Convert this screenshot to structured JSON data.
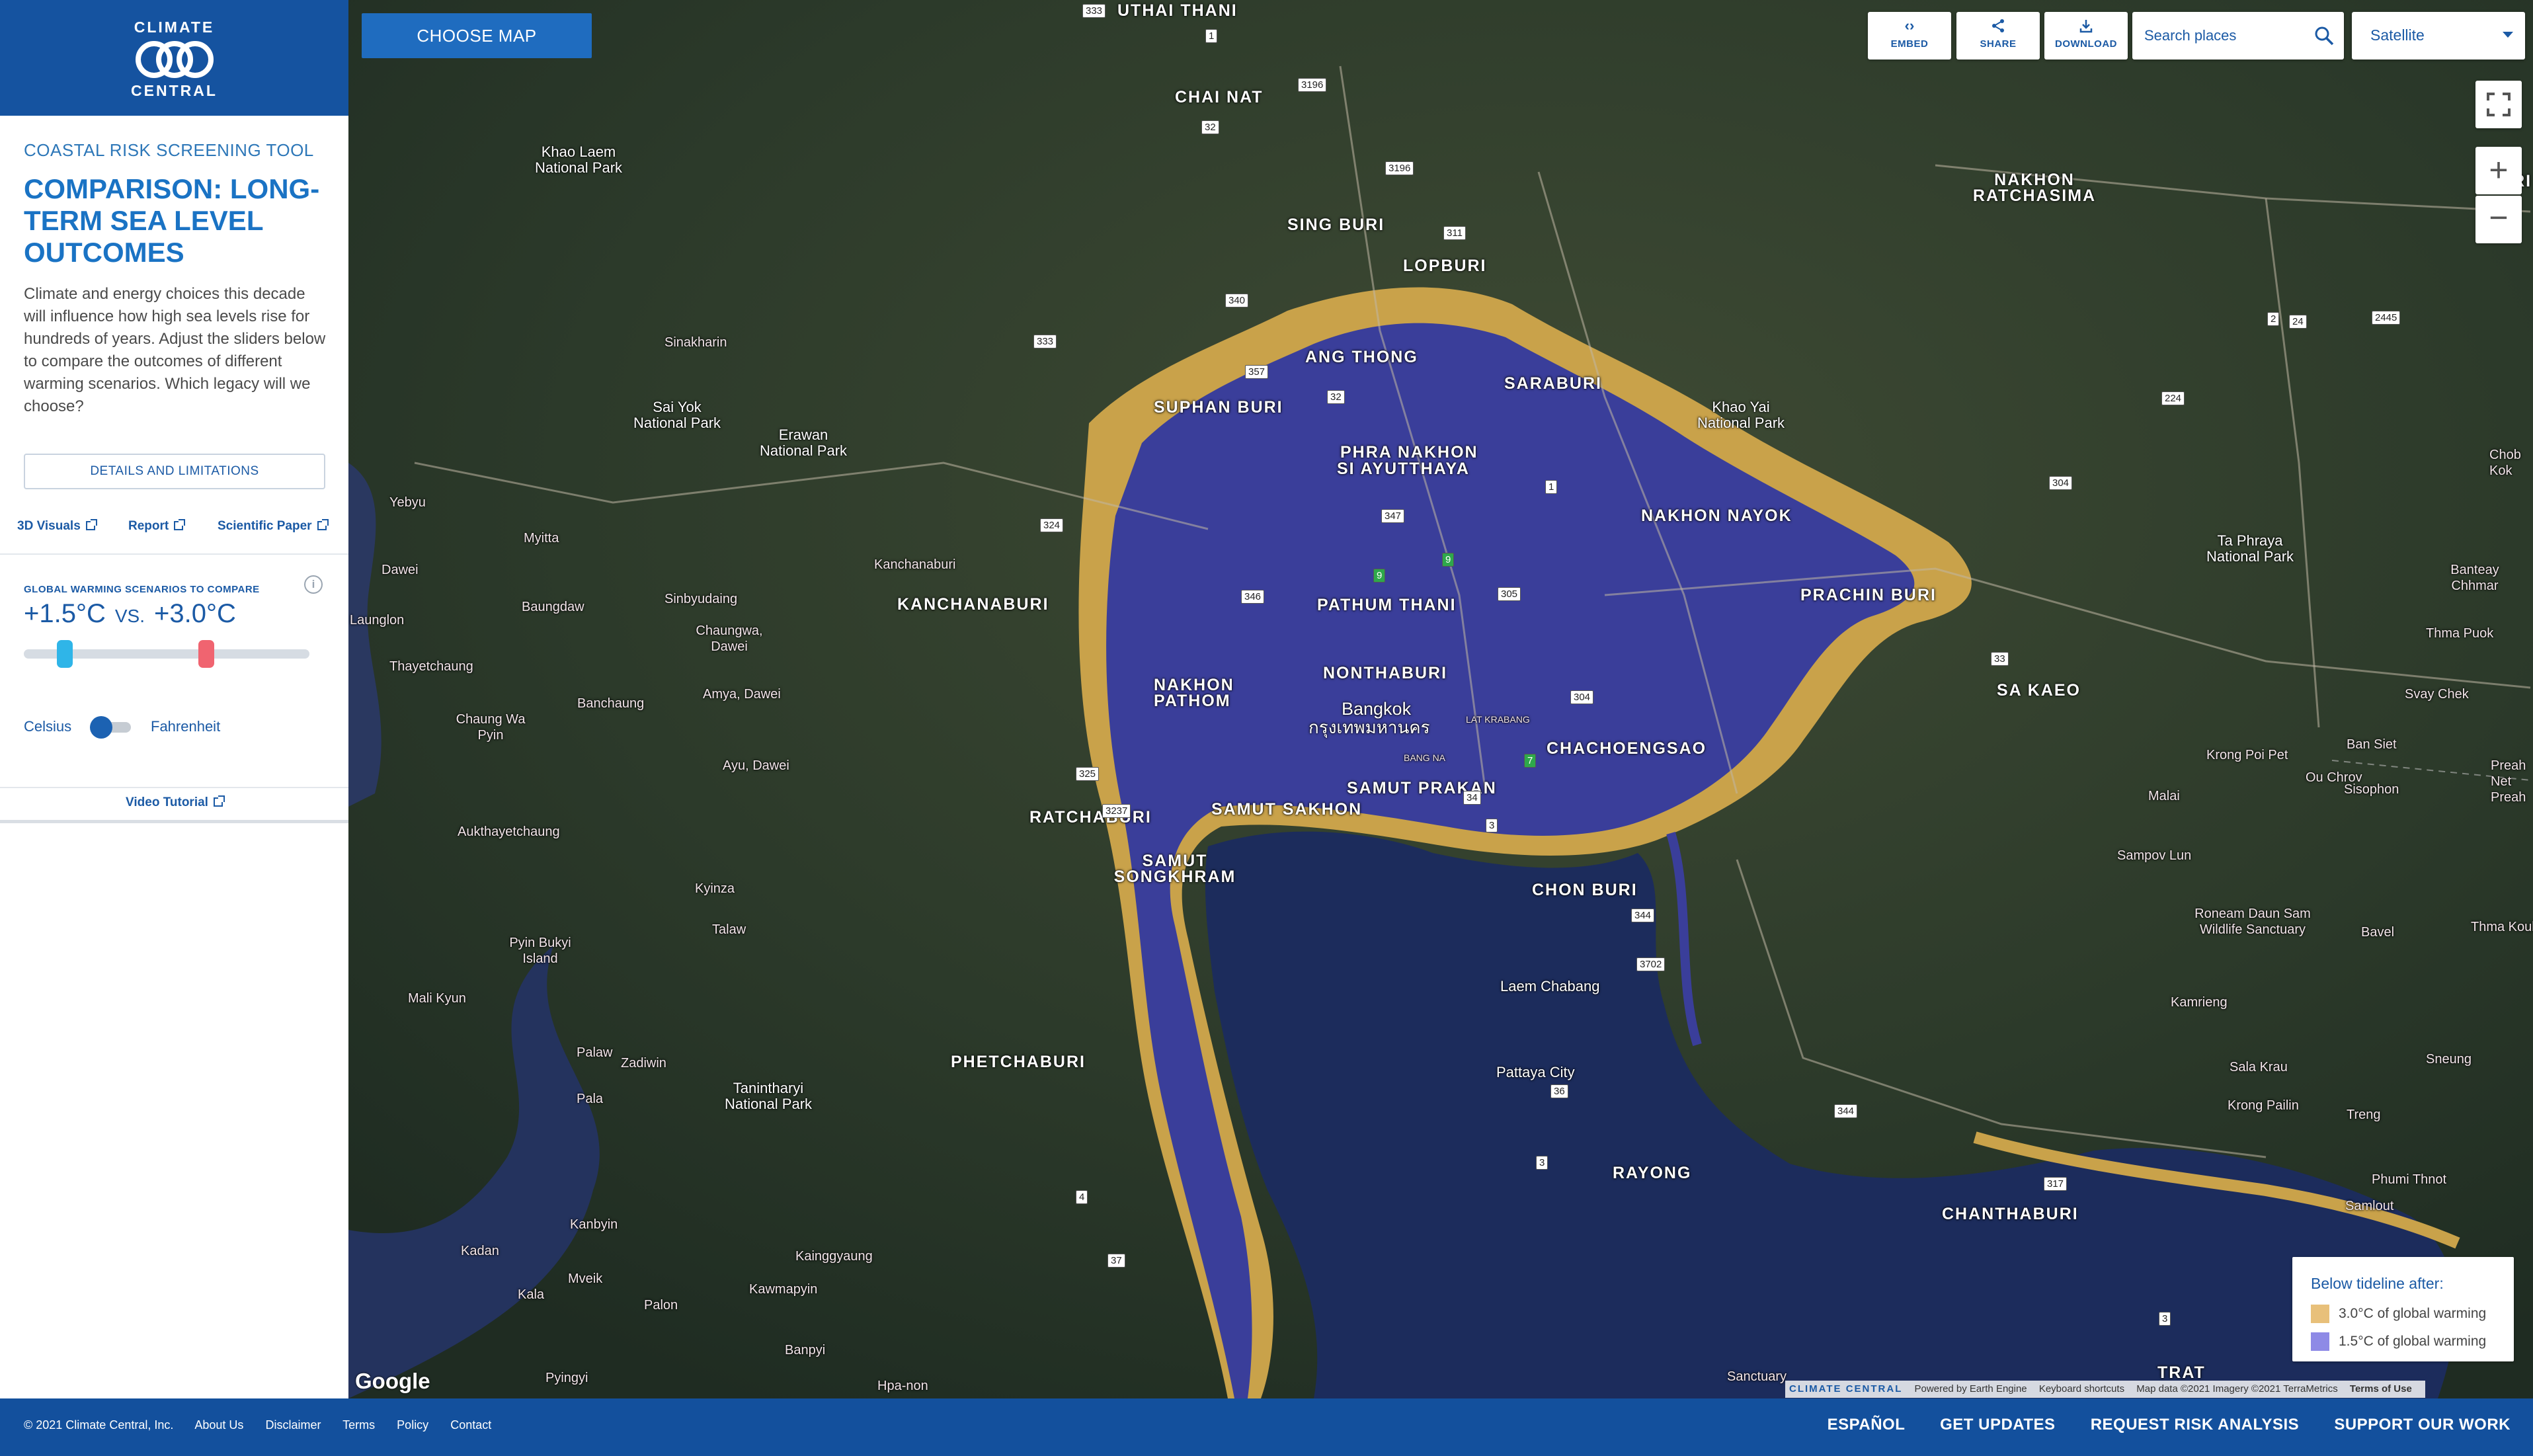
{
  "logo": {
    "line1": "CLIMATE",
    "line2": "CENTRAL"
  },
  "sidebar": {
    "tool_label": "COASTAL RISK SCREENING TOOL",
    "headline": "COMPARISON: LONG-TERM SEA LEVEL OUTCOMES",
    "intro": "Climate and energy choices this decade will influence how high sea levels rise for hundreds of years. Adjust the sliders below to compare the outcomes of different warming scenarios. Which legacy will we choose?",
    "details_button": "DETAILS AND LIMITATIONS",
    "links": [
      "3D Visuals",
      "Report",
      "Scientific Paper"
    ],
    "scenarios_label": "GLOBAL WARMING SCENARIOS TO COMPARE",
    "info_icon": "i",
    "scenario_low": "+1.5°C",
    "vs": "VS.",
    "scenario_high": "+3.0°C",
    "unit_celsius": "Celsius",
    "unit_fahrenheit": "Fahrenheit",
    "video_link": "Video Tutorial"
  },
  "toolbar": {
    "choose_map": "CHOOSE MAP",
    "embed": "EMBED",
    "share": "SHARE",
    "download": "DOWNLOAD",
    "search_placeholder": "Search places",
    "basemap": "Satellite"
  },
  "map_controls": {
    "zoom_in": "+",
    "zoom_out": "−"
  },
  "legend": {
    "title": "Below tideline after:",
    "items": [
      {
        "label": "3.0°C of global warming",
        "color": "#e8c07a"
      },
      {
        "label": "1.5°C of global warming",
        "color": "#8e8ae6"
      }
    ]
  },
  "map_colors": {
    "flood_high": "#c9a24a",
    "flood_low": "#3a3e9a",
    "sea": "#1c2c5c",
    "land": "#2f3d2e"
  },
  "places": {
    "uthai_thani": "UTHAI THANI",
    "chai_nat": "CHAI NAT",
    "sing_buri": "SING BURI",
    "lopburi": "LOPBURI",
    "ang_thong": "ANG THONG",
    "saraburi": "SARABURI",
    "suphan_buri": "SUPHAN BURI",
    "phra_nakhon": "PHRA NAKHON",
    "si_ayutthaya": "SI AYUTTHAYA",
    "nakhon_nayok": "NAKHON NAYOK",
    "prachin_buri": "PRACHIN BURI",
    "pathum_thani": "PATHUM THANI",
    "kanchanaburi": "KANCHANABURI",
    "nonthaburi": "NONTHABURI",
    "nakhon_pathom": "NAKHON PATHOM",
    "bangkok": "Bangkok",
    "bangkok_thai": "กรุงเทพมหานคร",
    "chachoengsao": "CHACHOENGSAO",
    "samut_prakan": "SAMUT PRAKAN",
    "samut_sakhon": "SAMUT SAKHON",
    "ratchaburi": "RATCHABURI",
    "samut_songkhram": "SAMUT SONGKHRAM",
    "chon_buri": "CHON BURI",
    "sa_kaeo": "SA KAEO",
    "nakhon_ratchasima": "NAKHON RATCHASIMA",
    "buri": "BURI",
    "phetchaburi": "PHETCHABURI",
    "rayong": "RAYONG",
    "chanthaburi": "CHANTHABURI",
    "trat": "TRAT",
    "khao_laem": "Khao Laem National Park",
    "sai_yok": "Sai Yok National Park",
    "erawan": "Erawan National Park",
    "khao_yai": "Khao Yai National Park",
    "ta_phraya": "Ta Phraya National Park",
    "tanintharyi": "Tanintharyi National Park",
    "laem_chabang": "Laem Chabang",
    "pattaya": "Pattaya City",
    "sinbyudaing": "Sinbyudaing",
    "chaungwa": "Chaungwa, Dawei",
    "dawei": "Dawei",
    "baungdaw": "Baungdaw",
    "myitta": "Myitta",
    "banchaung": "Banchaung",
    "amya": "Amya, Dawei",
    "ayu": "Ayu, Dawei",
    "kyinza": "Kyinza",
    "talaw": "Talaw",
    "mali_kyun": "Mali Kyun",
    "palaw": "Palaw",
    "zadiwin": "Zadiwin",
    "pala": "Pala",
    "kanbyin": "Kanbyin",
    "kadan": "Kadan",
    "kala": "Kala",
    "mveik": "Mveik",
    "palon": "Palon",
    "kainggyaung": "Kainggyaung",
    "kawmapyin": "Kawmapyin",
    "banpyi": "Banpyi",
    "pyingyi": "Pyingyi",
    "hpa_non": "Hpa-non",
    "thayetchaung": "Thayetchaung",
    "aukthayetchaung": "Aukthayetchaung",
    "launglon": "Launglon",
    "yebyu": "Yebyu",
    "chaung_wa_pyin": "Chaung Wa Pyin",
    "pyin_bukyi": "Pyin Bukyi Island",
    "krong_poi_pet": "Krong Poi Pet",
    "ou_chrov": "Ou Chrov",
    "sisophon": "Sisophon",
    "svay_chek": "Svay Chek",
    "ban_siet": "Ban Siet",
    "thma_puok": "Thma Puok",
    "banteay": "Banteay Chhmar",
    "roneam_daun": "Roneam Daun Sam Wildlife Sanctuary",
    "sampov_lun": "Sampov Lun",
    "kamrieng": "Kamrieng",
    "sala_krau": "Sala Krau",
    "krong_pailin": "Krong Pailin",
    "treng": "Treng",
    "phumi_thnot": "Phumi Thnot",
    "samlout": "Samlout",
    "sanctuary": "Sanctuary",
    "sinakharin": "Sinakharin",
    "kanchanaburi_small": "Kanchanaburi",
    "malai": "Malai",
    "preah_net": "Preah Net Preah",
    "thma_koul": "Thma Koul",
    "bavel": "Bavel",
    "sneung": "Sneung",
    "chob_kok": "Chob Kok",
    "bang_na": "BANG NA",
    "lat_krabang": "LAT KRABANG"
  },
  "map": {
    "google": "Google",
    "attr_brand": "CLIMATE CENTRAL",
    "attr_engine": "Powered by Earth Engine",
    "attr_keys": "Keyboard shortcuts",
    "attr_data": "Map data ©2021 Imagery ©2021 TerraMetrics",
    "attr_terms": "Terms of Use"
  },
  "footer": {
    "copyright": "© 2021 Climate Central, Inc.",
    "links": [
      "About Us",
      "Disclaimer",
      "Terms",
      "Policy",
      "Contact"
    ],
    "nav": [
      "ESPAÑOL",
      "GET UPDATES",
      "REQUEST RISK ANALYSIS",
      "SUPPORT OUR WORK"
    ]
  }
}
